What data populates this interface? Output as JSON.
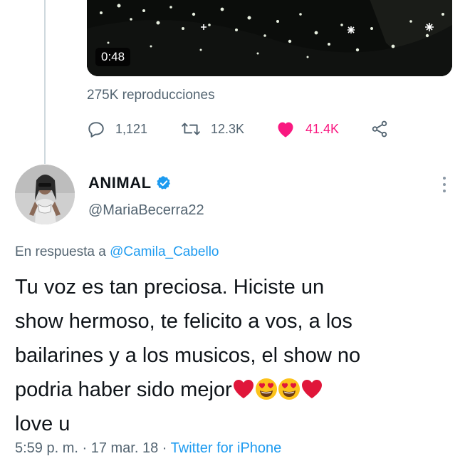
{
  "video": {
    "duration": "0:48",
    "views": "275K reproducciones"
  },
  "actions": {
    "replies": "1,121",
    "retweets": "12.3K",
    "likes": "41.4K"
  },
  "author": {
    "name": "ANIMAL",
    "handle": "@MariaBecerra22"
  },
  "reply": {
    "prefix": "En respuesta a ",
    "mention": "@Camila_Cabello"
  },
  "tweet": {
    "text_part1": "Tu voz es tan preciosa. Hiciste un\nshow hermoso, te felicito a vos, a los\nbailarines y a los musicos, el show no\npodria haber sido mejor",
    "text_part2": "\nlove u",
    "emojis": [
      "red-heart",
      "heart-eyes",
      "heart-eyes",
      "red-heart"
    ]
  },
  "meta": {
    "time": "5:59 p. m.",
    "sep1": " · ",
    "date": "17 mar. 18",
    "sep2": " · ",
    "source": "Twitter for iPhone"
  },
  "colors": {
    "like": "#f91880",
    "link": "#1d9bf0",
    "secondary": "#536471",
    "verified": "#1d9bf0"
  }
}
